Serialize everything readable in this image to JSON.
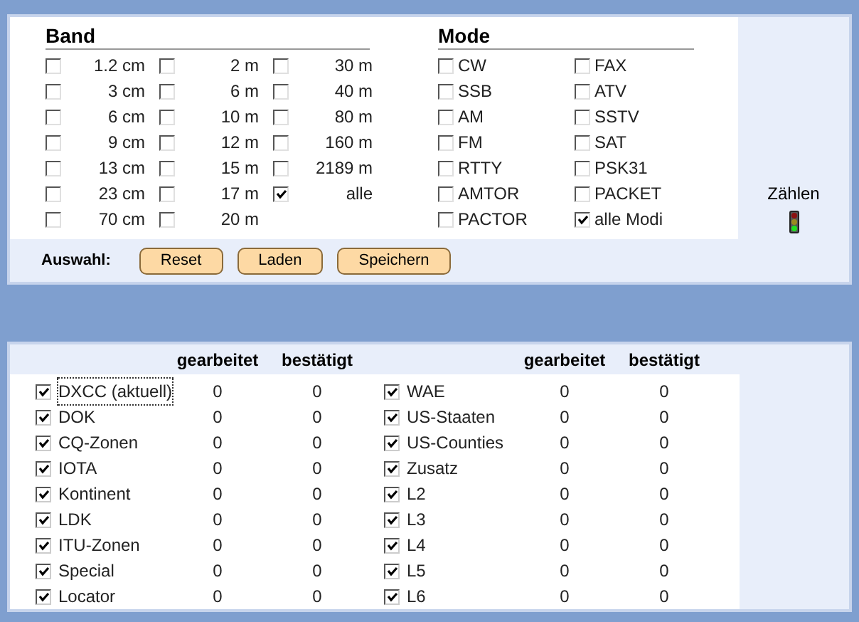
{
  "band": {
    "title": "Band",
    "items": [
      {
        "label": "1.2 cm",
        "checked": false
      },
      {
        "label": "3 cm",
        "checked": false
      },
      {
        "label": "6 cm",
        "checked": false
      },
      {
        "label": "9 cm",
        "checked": false
      },
      {
        "label": "13 cm",
        "checked": false
      },
      {
        "label": "23 cm",
        "checked": false
      },
      {
        "label": "70 cm",
        "checked": false
      },
      {
        "label": "2 m",
        "checked": false
      },
      {
        "label": "6 m",
        "checked": false
      },
      {
        "label": "10 m",
        "checked": false
      },
      {
        "label": "12 m",
        "checked": false
      },
      {
        "label": "15 m",
        "checked": false
      },
      {
        "label": "17 m",
        "checked": false
      },
      {
        "label": "20 m",
        "checked": false
      },
      {
        "label": "30 m",
        "checked": false
      },
      {
        "label": "40 m",
        "checked": false
      },
      {
        "label": "80 m",
        "checked": false
      },
      {
        "label": "160 m",
        "checked": false
      },
      {
        "label": "2189 m",
        "checked": false
      },
      {
        "label": "alle",
        "checked": true
      }
    ]
  },
  "mode": {
    "title": "Mode",
    "items": [
      {
        "label": "CW",
        "checked": false
      },
      {
        "label": "SSB",
        "checked": false
      },
      {
        "label": "AM",
        "checked": false
      },
      {
        "label": "FM",
        "checked": false
      },
      {
        "label": "RTTY",
        "checked": false
      },
      {
        "label": "AMTOR",
        "checked": false
      },
      {
        "label": "PACTOR",
        "checked": false
      },
      {
        "label": "FAX",
        "checked": false
      },
      {
        "label": "ATV",
        "checked": false
      },
      {
        "label": "SSTV",
        "checked": false
      },
      {
        "label": "SAT",
        "checked": false
      },
      {
        "label": "PSK31",
        "checked": false
      },
      {
        "label": "PACKET",
        "checked": false
      },
      {
        "label": "alle Modi",
        "checked": true
      }
    ]
  },
  "selection": {
    "label": "Auswahl:",
    "buttons": [
      "Reset",
      "Laden",
      "Speichern"
    ]
  },
  "count": {
    "label": "Zählen"
  },
  "table": {
    "halves": [
      {
        "columns": [
          "gearbeitet",
          "bestätigt"
        ],
        "rows": [
          {
            "name": "DXCC (aktuell)",
            "checked": true,
            "focused": true,
            "worked": "0",
            "confirmed": "0"
          },
          {
            "name": "DOK",
            "checked": true,
            "focused": false,
            "worked": "0",
            "confirmed": "0"
          },
          {
            "name": "CQ-Zonen",
            "checked": true,
            "focused": false,
            "worked": "0",
            "confirmed": "0"
          },
          {
            "name": "IOTA",
            "checked": true,
            "focused": false,
            "worked": "0",
            "confirmed": "0"
          },
          {
            "name": "Kontinent",
            "checked": true,
            "focused": false,
            "worked": "0",
            "confirmed": "0"
          },
          {
            "name": "LDK",
            "checked": true,
            "focused": false,
            "worked": "0",
            "confirmed": "0"
          },
          {
            "name": "ITU-Zonen",
            "checked": true,
            "focused": false,
            "worked": "0",
            "confirmed": "0"
          },
          {
            "name": "Special",
            "checked": true,
            "focused": false,
            "worked": "0",
            "confirmed": "0"
          },
          {
            "name": "Locator",
            "checked": true,
            "focused": false,
            "worked": "0",
            "confirmed": "0"
          }
        ]
      },
      {
        "columns": [
          "gearbeitet",
          "bestätigt"
        ],
        "rows": [
          {
            "name": "WAE",
            "checked": true,
            "focused": false,
            "worked": "0",
            "confirmed": "0"
          },
          {
            "name": "US-Staaten",
            "checked": true,
            "focused": false,
            "worked": "0",
            "confirmed": "0"
          },
          {
            "name": "US-Counties",
            "checked": true,
            "focused": false,
            "worked": "0",
            "confirmed": "0"
          },
          {
            "name": "Zusatz",
            "checked": true,
            "focused": false,
            "worked": "0",
            "confirmed": "0"
          },
          {
            "name": "L2",
            "checked": true,
            "focused": false,
            "worked": "0",
            "confirmed": "0"
          },
          {
            "name": "L3",
            "checked": true,
            "focused": false,
            "worked": "0",
            "confirmed": "0"
          },
          {
            "name": "L4",
            "checked": true,
            "focused": false,
            "worked": "0",
            "confirmed": "0"
          },
          {
            "name": "L5",
            "checked": true,
            "focused": false,
            "worked": "0",
            "confirmed": "0"
          },
          {
            "name": "L6",
            "checked": true,
            "focused": false,
            "worked": "0",
            "confirmed": "0"
          }
        ]
      }
    ]
  }
}
